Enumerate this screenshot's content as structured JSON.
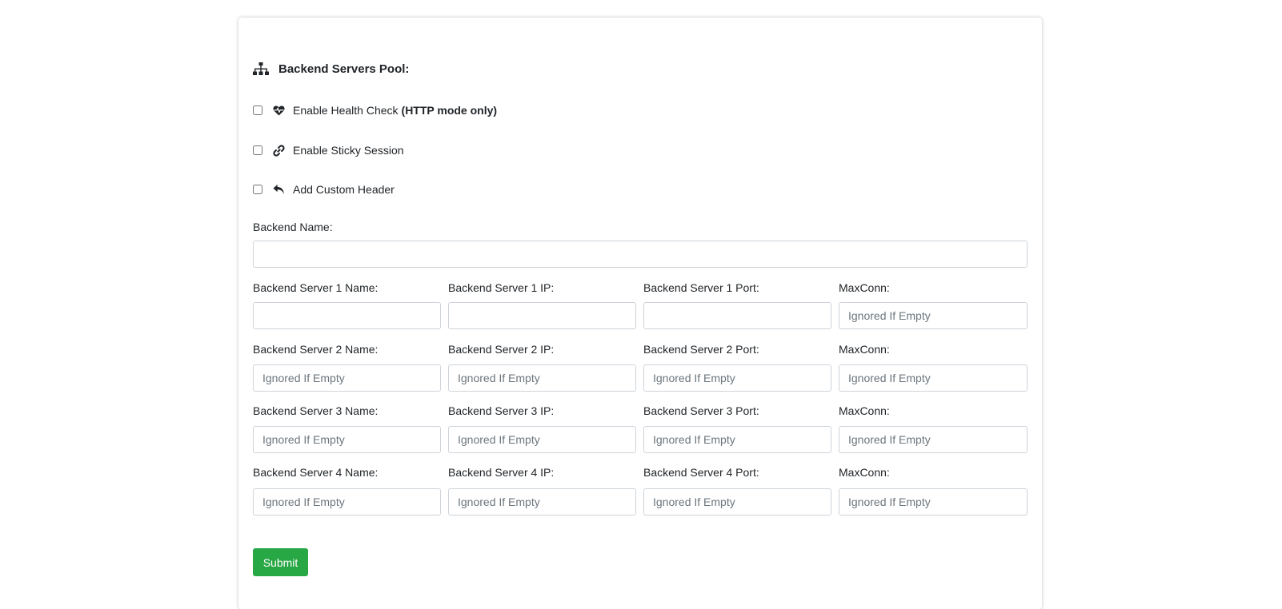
{
  "section": {
    "title": "Backend Servers Pool:",
    "icon": "sitemap-icon"
  },
  "options": [
    {
      "label": "Enable Health Check",
      "bold_suffix": "(HTTP mode only)",
      "icon": "heartbeat-icon",
      "checked": false
    },
    {
      "label": "Enable Sticky Session",
      "bold_suffix": "",
      "icon": "link-icon",
      "checked": false
    },
    {
      "label": "Add Custom Header",
      "bold_suffix": "",
      "icon": "reply-icon",
      "checked": false
    }
  ],
  "backend_name": {
    "label": "Backend Name:",
    "value": "",
    "placeholder": ""
  },
  "servers": [
    {
      "name_label": "Backend Server 1 Name:",
      "name_placeholder": "",
      "ip_label": "Backend Server 1 IP:",
      "ip_placeholder": "",
      "port_label": "Backend Server 1 Port:",
      "port_placeholder": "",
      "maxconn_label": "MaxConn:",
      "maxconn_placeholder": "Ignored If Empty"
    },
    {
      "name_label": "Backend Server 2 Name:",
      "name_placeholder": "Ignored If Empty",
      "ip_label": "Backend Server 2 IP:",
      "ip_placeholder": "Ignored If Empty",
      "port_label": "Backend Server 2 Port:",
      "port_placeholder": "Ignored If Empty",
      "maxconn_label": "MaxConn:",
      "maxconn_placeholder": "Ignored If Empty"
    },
    {
      "name_label": "Backend Server 3 Name:",
      "name_placeholder": "Ignored If Empty",
      "ip_label": "Backend Server 3 IP:",
      "ip_placeholder": "Ignored If Empty",
      "port_label": "Backend Server 3 Port:",
      "port_placeholder": "Ignored If Empty",
      "maxconn_label": "MaxConn:",
      "maxconn_placeholder": "Ignored If Empty"
    },
    {
      "name_label": "Backend Server 4 Name:",
      "name_placeholder": "Ignored If Empty",
      "ip_label": "Backend Server 4 IP:",
      "ip_placeholder": "Ignored If Empty",
      "port_label": "Backend Server 4 Port:",
      "port_placeholder": "Ignored If Empty",
      "maxconn_label": "MaxConn:",
      "maxconn_placeholder": "Ignored If Empty"
    }
  ],
  "submit_label": "Submit",
  "colors": {
    "submit_bg": "#28a745",
    "input_border": "#ced4da",
    "placeholder": "#6c757d"
  }
}
